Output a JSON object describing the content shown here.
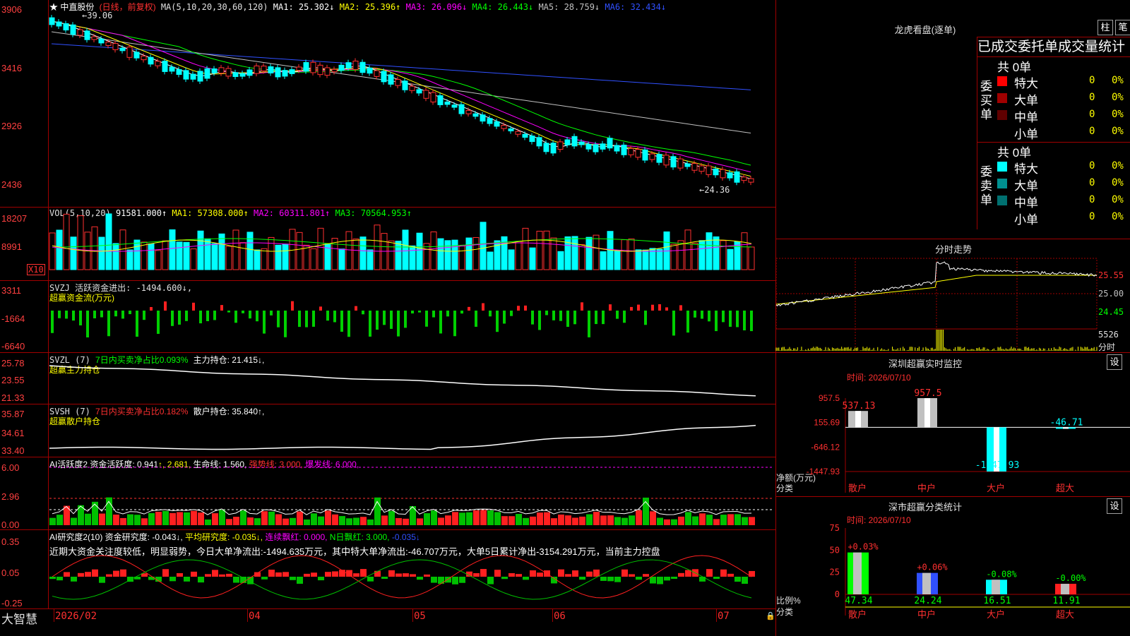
{
  "app": {
    "name": "大智慧"
  },
  "kline": {
    "title": "★ 中直股份",
    "period": "(日线，前复权)",
    "ma_params": "MA(5,10,20,30,60,120)",
    "ma": [
      {
        "label": "MA1: 25.302↓",
        "color": "#ffffff"
      },
      {
        "label": "MA2: 25.396↑",
        "color": "#ffff00"
      },
      {
        "label": "MA3: 26.096↓",
        "color": "#ff00ff"
      },
      {
        "label": "MA4: 26.443↓",
        "color": "#00ff00"
      },
      {
        "label": "MA5: 28.759↓",
        "color": "#c0c0c0"
      },
      {
        "label": "MA6: 32.434↓",
        "color": "#3050ff"
      }
    ],
    "y_labels": [
      "3906",
      "3416",
      "2926",
      "2436"
    ],
    "high_marker": "←39.06",
    "low_marker": "←24.36"
  },
  "vol": {
    "title": "VOL(5,10,20)",
    "value": "91581.000↑",
    "ma": [
      {
        "label": "MA1: 57308.000↑",
        "color": "#ffff00"
      },
      {
        "label": "MA2: 60311.801↑",
        "color": "#ff00ff"
      },
      {
        "label": "MA3: 70564.953↑",
        "color": "#00ff00"
      }
    ],
    "y_labels": [
      "18207",
      "8991"
    ],
    "unit": "X10"
  },
  "svzj": {
    "title": "SVZJ  活跃资金进出: -1494.600↓,",
    "subtitle": "超赢资金流(万元)",
    "y_labels": [
      "3311",
      "-1664",
      "-6640"
    ]
  },
  "svzl": {
    "prefix": "SVZL (7)",
    "part1": "7日内买卖净占比0.093%",
    "part2": "主力持仓: 21.415↓,",
    "subtitle": "超赢主力持仓",
    "y_labels": [
      "25.78",
      "23.55",
      "21.33"
    ]
  },
  "svsh": {
    "prefix": "SVSH (7)",
    "part1": "7日内买卖净占比0.182%",
    "part2": "散户持仓: 35.840↑,",
    "subtitle": "超赢散户持仓",
    "y_labels": [
      "35.87",
      "34.61",
      "33.40"
    ]
  },
  "ai_active": {
    "p1": "AI活跃度2 资金活跃度: 0.941",
    "p2": "↑, 2.681,",
    "p3": " 生命线: 1.560,",
    "p4": " 强势线: 3.000,",
    "p5": " 爆发线: 6.000,",
    "y_labels": [
      "6.00",
      "2.96",
      "0.00"
    ]
  },
  "ai_research": {
    "p1": "AI研究度2(10) 资金研究度: -0.043↓,",
    "p2": " 平均研究度: -0.035↓,",
    "p3": " 连续飘红: 0.000,",
    "p4": " N日飘红: 3.000,",
    "p5": " -0.035↓",
    "commentary": "近期大资金关注度较低，明显弱势，今日大单净流出:-1494.635万元，其中特大单净流出:-46.707万元，大单5日累计净出-3154.291万元，当前主力控盘",
    "y_labels": [
      "0.35",
      "0.05",
      "-0.25"
    ]
  },
  "x_axis": [
    "2026/02",
    "04",
    "05",
    "06",
    "07"
  ],
  "dragon": {
    "title": "龙虎看盘(逐单)",
    "btn1": "柱",
    "btn2": "笔",
    "header": "已成交委托单成交量统计",
    "buy_label": "委买单",
    "sell_label": "委卖单",
    "buy_total": "共 0单",
    "sell_total": "共 0单",
    "buy_rows": [
      {
        "label": "特大",
        "count": "0",
        "pct": "0%",
        "color": "#ff0000"
      },
      {
        "label": "大单",
        "count": "0",
        "pct": "0%",
        "color": "#a00000"
      },
      {
        "label": "中单",
        "count": "0",
        "pct": "0%",
        "color": "#600000"
      },
      {
        "label": "小单",
        "count": "0",
        "pct": "0%",
        "color": "#000000"
      }
    ],
    "sell_rows": [
      {
        "label": "特大",
        "count": "0",
        "pct": "0%",
        "color": "#00ffff"
      },
      {
        "label": "大单",
        "count": "0",
        "pct": "0%",
        "color": "#009090"
      },
      {
        "label": "中单",
        "count": "0",
        "pct": "0%",
        "color": "#007070"
      },
      {
        "label": "小单",
        "count": "0",
        "pct": "0%",
        "color": "#000000"
      }
    ]
  },
  "intraday": {
    "title": "分时走势",
    "prices": [
      "25.55",
      "25.00",
      "24.45"
    ],
    "vol_value": "5526",
    "vol_unit": "分时"
  },
  "monitor": {
    "title": "深圳超赢实时监控",
    "btn": "设",
    "time": "时间: 2026/07/10",
    "y_labels": [
      "957.5",
      "155.69",
      "-646.12",
      "-1447.93"
    ],
    "unit": "净额(万元)",
    "unit2": "分类",
    "chart_data": {
      "type": "bar",
      "categories": [
        "散户",
        "中户",
        "大户",
        "超大"
      ],
      "values": [
        537.13,
        957.5,
        -1447.93,
        -46.71
      ],
      "ylim": [
        -1447.93,
        957.5
      ]
    }
  },
  "stats": {
    "title": "深市超赢分类统计",
    "btn": "设",
    "time": "时间: 2026/07/10",
    "y_labels": [
      "75",
      "50",
      "25",
      "0"
    ],
    "unit": "比例%",
    "unit2": "分类",
    "chart_data": {
      "type": "bar",
      "categories": [
        "散户",
        "中户",
        "大户",
        "超大"
      ],
      "values": [
        47.34,
        24.24,
        16.51,
        11.91
      ],
      "changes": [
        "+0.03%",
        "+0.06%",
        "-0.08%",
        "-0.00%"
      ],
      "ylim": [
        0,
        75
      ]
    }
  }
}
